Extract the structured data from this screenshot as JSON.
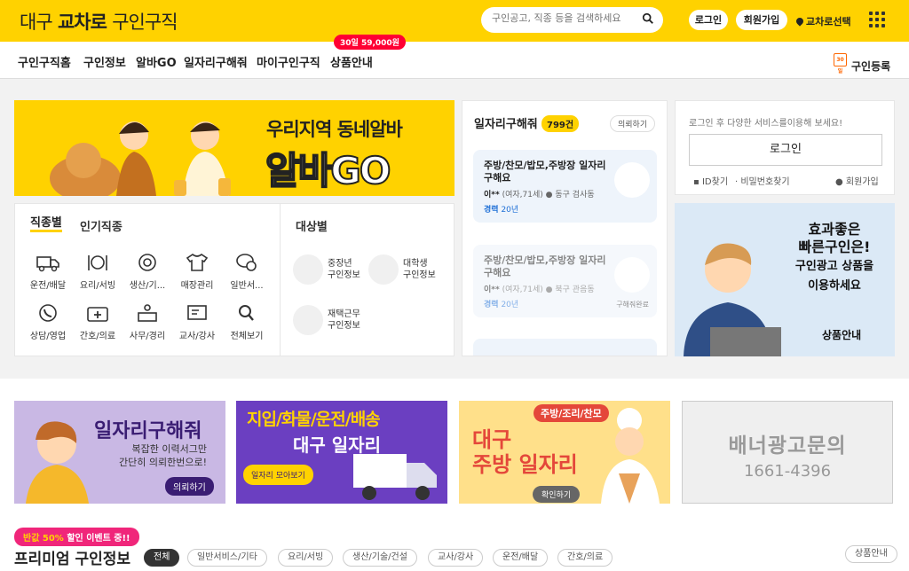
{
  "header": {
    "logo_pre": "대구",
    "logo_brand": "교차로",
    "logo_post": "구인구직",
    "search_placeholder": "구인공고, 직종 등을 검색하세요",
    "login": "로그인",
    "signup": "회원가입",
    "location": "교차로선택"
  },
  "nav": {
    "tabs": [
      "구인구직홈",
      "구인정보",
      "알바GO",
      "일자리구해줘",
      "마이구인구직",
      "상품안내"
    ],
    "badge": "30일 59,000원",
    "register": "구인등록",
    "register_icon_text": "30일"
  },
  "hero": {
    "line1": "우리지역 동네알바",
    "line2": "알바GO"
  },
  "job_categories": {
    "tab_by_job": "직종별",
    "tab_popular": "인기직종",
    "tab_by_target": "대상별",
    "items": [
      {
        "label": "운전/배달",
        "icon": "truck-icon"
      },
      {
        "label": "요리/서빙",
        "icon": "dish-icon"
      },
      {
        "label": "생산/기...",
        "icon": "gear-icon"
      },
      {
        "label": "매장관리",
        "icon": "shirt-icon"
      },
      {
        "label": "일반서...",
        "icon": "chat-icon"
      },
      {
        "label": "상담/영업",
        "icon": "phone-icon"
      },
      {
        "label": "간호/의료",
        "icon": "medical-icon"
      },
      {
        "label": "사무/경리",
        "icon": "desk-icon"
      },
      {
        "label": "교사/강사",
        "icon": "board-icon"
      },
      {
        "label": "전체보기",
        "icon": "search-icon"
      }
    ],
    "targets": [
      {
        "title": "중장년",
        "sub": "구인정보"
      },
      {
        "title": "대학생",
        "sub": "구인정보"
      },
      {
        "title": "재택근무",
        "sub": "구인정보"
      }
    ]
  },
  "seekers": {
    "title": "일자리구해줘",
    "count": "799건",
    "request": "의뢰하기",
    "cards": [
      {
        "title": "주방/찬모/밥모,주방장 일자리 구해요",
        "name": "이**",
        "meta": "(여자,71세)",
        "place": "동구 검사동",
        "exp_label": "경력",
        "exp": "20년",
        "status": ""
      },
      {
        "title": "주방/찬모/밥모,주방장 일자리 구해요",
        "name": "이**",
        "meta": "(여자,71세)",
        "place": "북구 관음동",
        "exp_label": "경력",
        "exp": "20년",
        "status": "구해줘완료"
      }
    ]
  },
  "login_box": {
    "message": "로그인 후 다양한 서비스를이용해 보세요!",
    "button": "로그인",
    "find_id": "ID찾기",
    "find_pw": "비밀번호찾기",
    "join": "회원가입"
  },
  "side_ad": {
    "line1": "효과좋은",
    "line2": "빠른구인은!",
    "line3": "구인광고 상품을",
    "line4": "이용하세요",
    "more": "상품안내"
  },
  "banners": [
    {
      "title": "일자리구해줘",
      "sub1": "복잡한 이력서그만",
      "sub2": "간단히 의뢰한번으로!",
      "button": "의뢰하기"
    },
    {
      "title": "지입/화물/운전/배송",
      "sub": "대구 일자리",
      "button": "일자리 모아보기"
    },
    {
      "tag": "주방/조리/찬모",
      "title1": "대구",
      "title2": "주방 일자리",
      "button": "확인하기"
    },
    {
      "title": "배너광고문의",
      "phone": "1661-4396"
    }
  ],
  "premium": {
    "promo_pre": "반값",
    "promo_pct": "50%",
    "promo_post": "할인 이벤트 중!!",
    "title": "프리미엄 구인정보",
    "chips": [
      "전체",
      "일반서비스/기타",
      "요리/서빙",
      "생산/기술/건설",
      "교사/강사",
      "운전/배달",
      "간호/의료"
    ],
    "more": "상품안내"
  },
  "colors": {
    "brand": "#ffd200",
    "accent_red": "#ff0033",
    "link_blue": "#1e6fd6",
    "promo_pink": "#f0267a"
  }
}
